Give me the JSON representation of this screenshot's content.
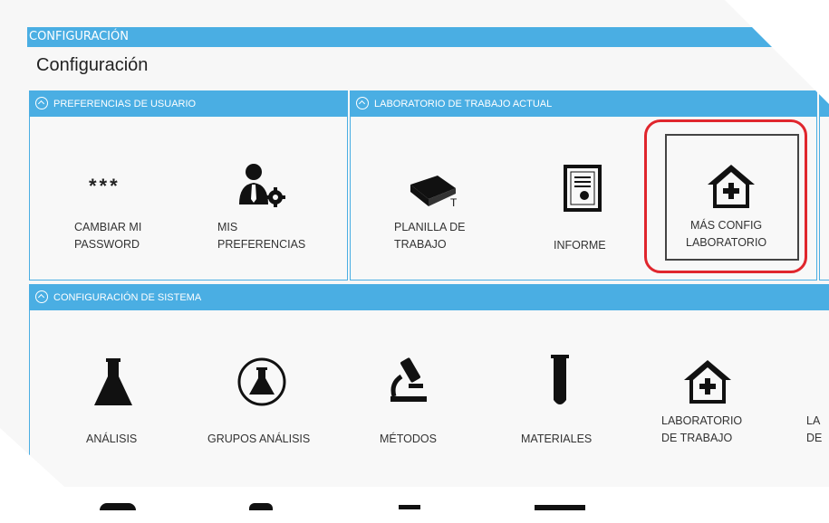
{
  "topbar": {
    "title": "CONFIGURACIÓN"
  },
  "page": {
    "title": "Configuración"
  },
  "panels": {
    "user_prefs": {
      "header": "PREFERENCIAS DE USUARIO",
      "tiles": [
        {
          "label": "CAMBIAR MI\nPASSWORD",
          "icon": "asterisks-icon",
          "glyph": "***"
        },
        {
          "label": "MIS\nPREFERENCIAS",
          "icon": "user-settings-icon"
        }
      ]
    },
    "lab": {
      "header": "LABORATORIO DE TRABAJO ACTUAL",
      "tiles": [
        {
          "label": "PLANILLA DE\nTRABAJO",
          "icon": "book-icon"
        },
        {
          "label": "INFORME",
          "icon": "certificate-icon"
        },
        {
          "label": "MÁS CONFIG\nLABORATORIO",
          "icon": "house-plus-icon"
        }
      ]
    },
    "system": {
      "header": "CONFIGURACIÓN DE SISTEMA",
      "tiles": [
        {
          "label": "ANÁLISIS",
          "icon": "flask-icon"
        },
        {
          "label": "GRUPOS ANÁLISIS",
          "icon": "flask-circle-icon"
        },
        {
          "label": "MÉTODOS",
          "icon": "microscope-icon"
        },
        {
          "label": "MATERIALES",
          "icon": "test-tube-icon"
        },
        {
          "label": "LABORATORIO\nDE TRABAJO",
          "icon": "house-plus-icon"
        },
        {
          "label": "LA\nDE",
          "icon": ""
        }
      ]
    }
  },
  "colors": {
    "accent": "#4aaee3",
    "highlight": "#e0262d",
    "text": "#333333"
  }
}
